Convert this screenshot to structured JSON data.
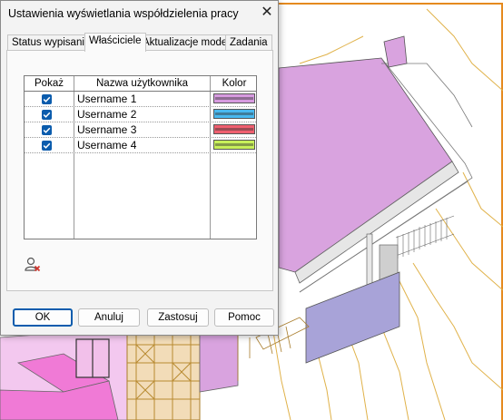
{
  "dialog": {
    "title": "Ustawienia wyświetlania współdzielenia pracy",
    "close_glyph": "✕"
  },
  "tabs": [
    {
      "label": "Status wypisania",
      "active": false
    },
    {
      "label": "Właściciele",
      "active": true
    },
    {
      "label": "Aktualizacje modelu",
      "active": false
    },
    {
      "label": "Zadania",
      "active": false
    }
  ],
  "table": {
    "headers": {
      "show": "Pokaż",
      "name": "Nazwa użytkownika",
      "color": "Kolor"
    },
    "rows": [
      {
        "checked": true,
        "name": "Username 1",
        "color": "#d79be0"
      },
      {
        "checked": true,
        "name": "Username 2",
        "color": "#49b8ef"
      },
      {
        "checked": true,
        "name": "Username 3",
        "color": "#ef5f6f"
      },
      {
        "checked": true,
        "name": "Username 4",
        "color": "#c8f05a"
      }
    ]
  },
  "buttons": {
    "ok": "OK",
    "cancel": "Anuluj",
    "apply": "Zastosuj",
    "help": "Pomoc"
  },
  "icons": {
    "remove_user": "remove-user-icon",
    "checkbox": "checkmark-icon"
  },
  "colors": {
    "accent": "#0b5cad",
    "model_magenta": "#d9a3df",
    "model_purple": "#a8a3d8",
    "model_pink": "#f079d6",
    "model_outline": "#e5b84a"
  }
}
